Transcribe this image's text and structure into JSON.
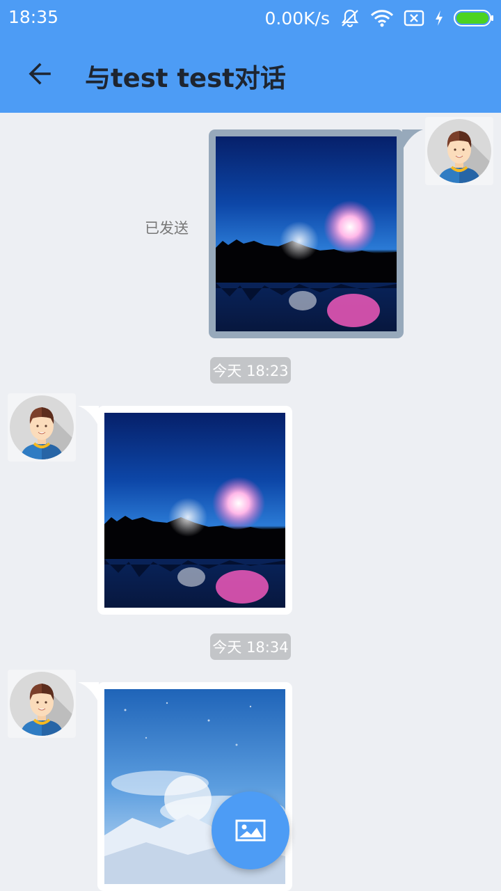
{
  "status_bar": {
    "time": "18:35",
    "net_speed": "0.00K/s",
    "icons": [
      "muted-bell-icon",
      "wifi-icon",
      "sim-off-icon",
      "charging-bolt-icon",
      "battery-icon"
    ]
  },
  "header": {
    "title": "与test test对话",
    "back_icon": "arrow-left-icon",
    "background_color": "#4d9cf5"
  },
  "messages": [
    {
      "direction": "outgoing",
      "content": "image",
      "image_subject": "fireworks over lake",
      "status": "已发送"
    },
    {
      "timestamp": "今天 18:23"
    },
    {
      "direction": "incoming",
      "content": "image",
      "image_subject": "fireworks over lake"
    },
    {
      "timestamp": "今天 18:34"
    },
    {
      "direction": "incoming",
      "content": "image",
      "image_subject": "moon in clouds"
    }
  ],
  "fab": {
    "icon": "image-icon",
    "color": "#4d9cf5"
  }
}
